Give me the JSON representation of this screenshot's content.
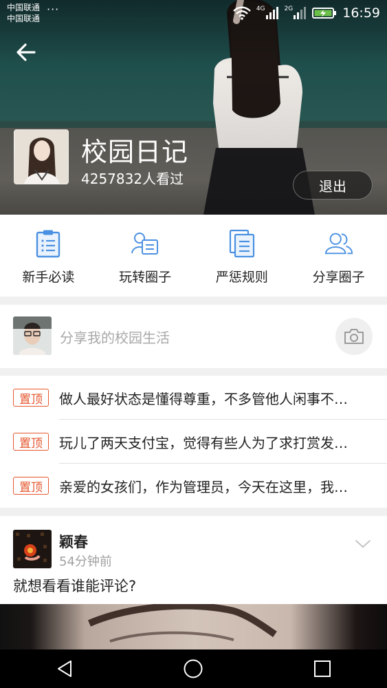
{
  "status_bar": {
    "carrier_1": "中国联通",
    "carrier_2": "中国联通",
    "more_dots": "···",
    "net_1": "4G",
    "net_2": "2G",
    "time": "16:59"
  },
  "header": {
    "group_title": "校园日记",
    "views": "4257832人看过",
    "exit_label": "退出"
  },
  "quick_nav": [
    {
      "label": "新手必读",
      "icon": "clipboard-list-icon"
    },
    {
      "label": "玩转圈子",
      "icon": "person-card-icon"
    },
    {
      "label": "严惩规则",
      "icon": "documents-icon"
    },
    {
      "label": "分享圈子",
      "icon": "users-icon"
    }
  ],
  "share": {
    "placeholder": "分享我的校园生活",
    "icon": "camera-icon"
  },
  "pinned": {
    "badge": "置顶",
    "items": [
      "做人最好状态是懂得尊重，不多管他人闲事不…",
      "玩儿了两天支付宝，觉得有些人为了求打赏发…",
      "亲爱的女孩们，作为管理员，今天在这里，我…"
    ]
  },
  "post": {
    "username": "颖春",
    "time": "54分钟前",
    "content": "就想看看谁能评论?"
  },
  "colors": {
    "accent_blue": "#4a90e2",
    "pin_red": "#e6562e"
  }
}
